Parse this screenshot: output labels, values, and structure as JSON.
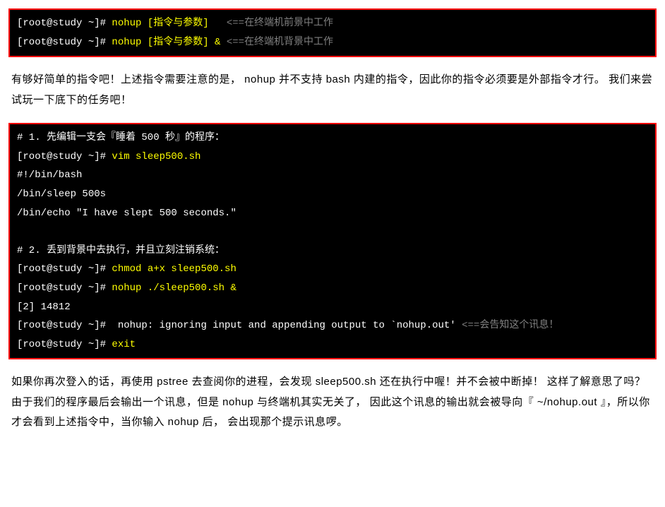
{
  "block1": {
    "line1": {
      "prompt": "[root@study ~]# ",
      "cmd": "nohup [指令与参数]",
      "sep": "   <==",
      "comment": "在终端机前景中工作"
    },
    "line2": {
      "prompt": "[root@study ~]# ",
      "cmd": "nohup [指令与参数] &",
      "sep": " <==",
      "comment": "在终端机背景中工作"
    }
  },
  "para1": "有够好简单的指令吧！上述指令需要注意的是， nohup 并不支持 bash 内建的指令，因此你的指令必须要是外部指令才行。 我们来尝试玩一下底下的任务吧！",
  "block2": {
    "l1": "# 1. 先编辑一支会『睡着 500 秒』的程序：",
    "l2_prompt": "[root@study ~]# ",
    "l2_cmd": "vim sleep500.sh",
    "l3": "#!/bin/bash",
    "l4": "/bin/sleep 500s",
    "l5": "/bin/echo \"I have slept 500 seconds.\"",
    "l_blank": " ",
    "l6": "# 2. 丢到背景中去执行，并且立刻注销系统：",
    "l7_prompt": "[root@study ~]# ",
    "l7_cmd": "chmod a+x sleep500.sh",
    "l8_prompt": "[root@study ~]# ",
    "l8_cmd": "nohup ./sleep500.sh &",
    "l9": "[2] 14812",
    "l10_prompt": "[root@study ~]#  ",
    "l10_text": "nohup: ignoring input and appending output to `nohup.out'",
    "l10_sep": " <==",
    "l10_comment": "会告知这个讯息！",
    "l11_prompt": "[root@study ~]# ",
    "l11_cmd": "exit"
  },
  "para2": "如果你再次登入的话，再使用 pstree 去查阅你的进程，会发现 sleep500.sh 还在执行中喔！并不会被中断掉！ 这样了解意思了吗？由于我们的程序最后会输出一个讯息，但是 nohup 与终端机其实无关了， 因此这个讯息的输出就会被导向『 ~/nohup.out 』，所以你才会看到上述指令中，当你输入 nohup 后， 会出现那个提示讯息啰。"
}
